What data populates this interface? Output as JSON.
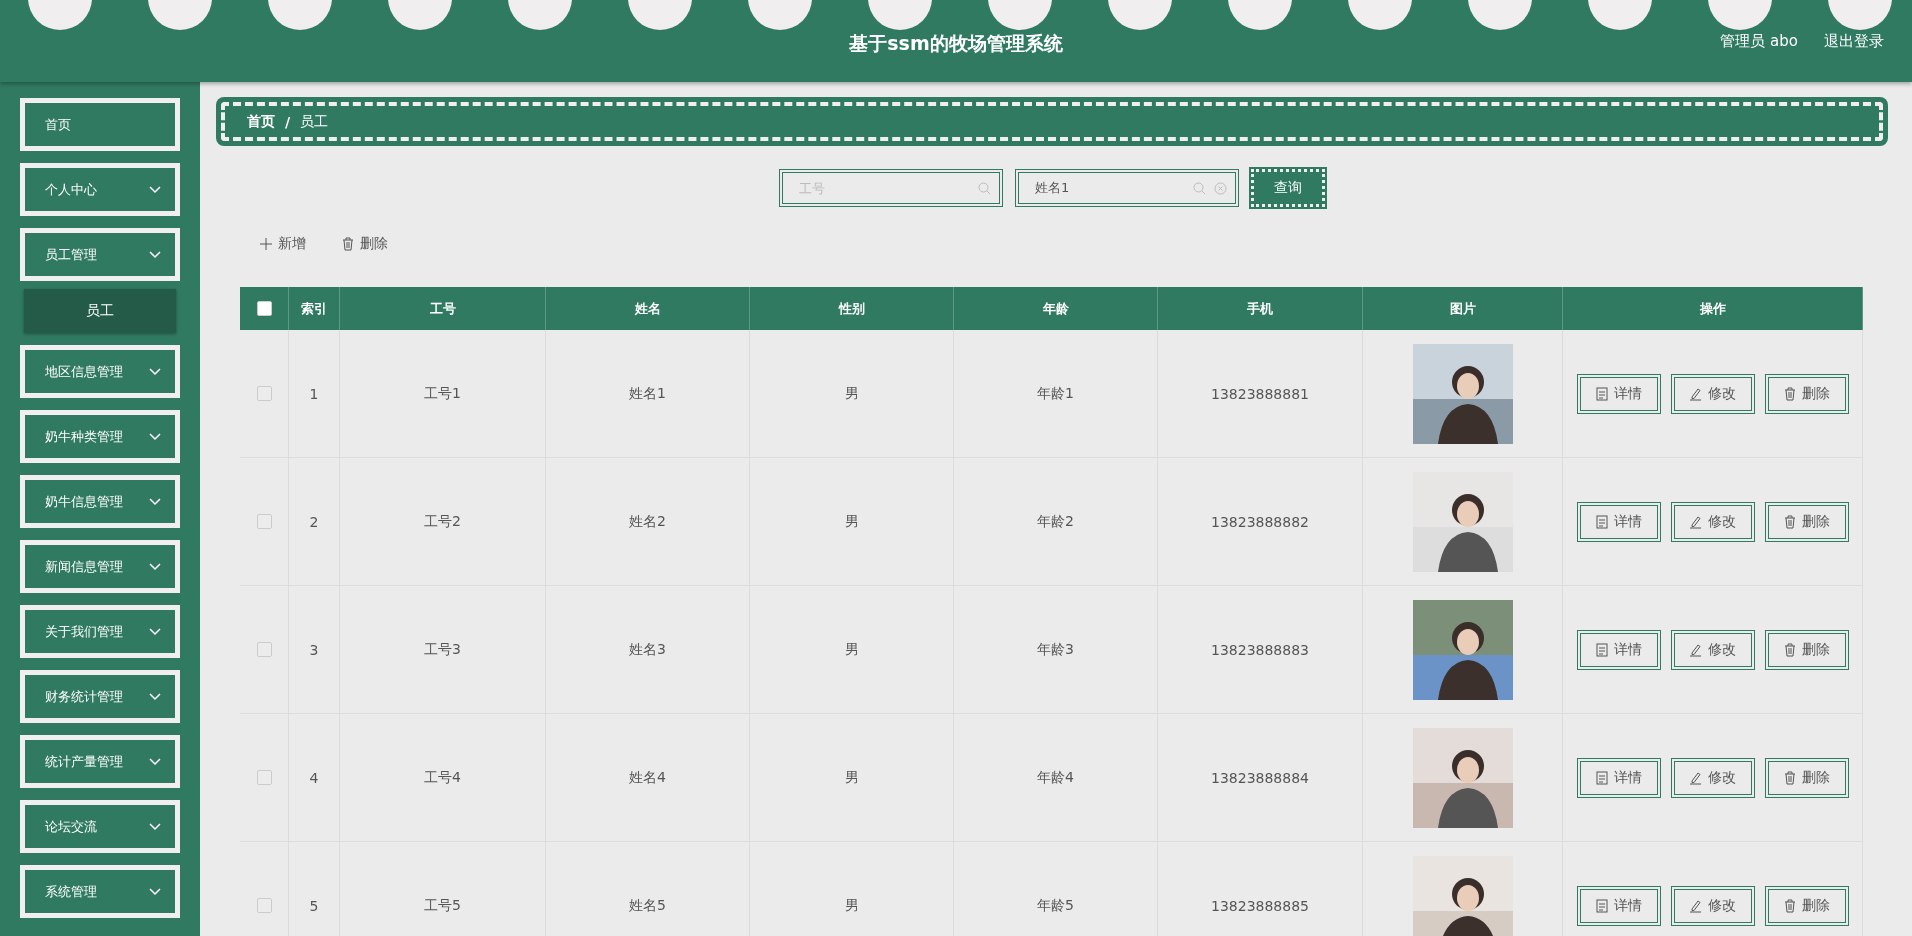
{
  "header": {
    "title": "基于ssm的牧场管理系统",
    "user": "管理员 abo",
    "logout": "退出登录"
  },
  "sidebar": {
    "items": [
      {
        "label": "首页",
        "kind": "link"
      },
      {
        "label": "个人中心",
        "kind": "submenu"
      },
      {
        "label": "员工管理",
        "kind": "submenu",
        "children": [
          {
            "label": "员工",
            "selected": true
          }
        ]
      },
      {
        "label": "地区信息管理",
        "kind": "submenu"
      },
      {
        "label": "奶牛种类管理",
        "kind": "submenu"
      },
      {
        "label": "奶牛信息管理",
        "kind": "submenu"
      },
      {
        "label": "新闻信息管理",
        "kind": "submenu"
      },
      {
        "label": "关于我们管理",
        "kind": "submenu"
      },
      {
        "label": "财务统计管理",
        "kind": "submenu"
      },
      {
        "label": "统计产量管理",
        "kind": "submenu"
      },
      {
        "label": "论坛交流",
        "kind": "submenu"
      },
      {
        "label": "系统管理",
        "kind": "submenu"
      }
    ]
  },
  "breadcrumb": {
    "items": [
      "首页",
      "员工"
    ],
    "separator": "/"
  },
  "search": {
    "fields": [
      {
        "placeholder": "工号"
      },
      {
        "value": "姓名1"
      }
    ],
    "button": "查询"
  },
  "actions": {
    "add": "新增",
    "delete": "删除"
  },
  "table": {
    "header_checked": false,
    "columns": [
      "索引",
      "工号",
      "姓名",
      "性别",
      "年龄",
      "手机",
      "图片",
      "操作"
    ],
    "rows": [
      {
        "checked": false,
        "cells": [
          "1",
          "工号1",
          "姓名1",
          "男",
          "年龄1",
          "13823888881"
        ],
        "buttons": [
          "详情",
          "修改",
          "删除"
        ]
      },
      {
        "checked": false,
        "cells": [
          "2",
          "工号2",
          "姓名2",
          "男",
          "年龄2",
          "13823888882"
        ],
        "buttons": [
          "详情",
          "修改",
          "删除"
        ]
      },
      {
        "checked": false,
        "cells": [
          "3",
          "工号3",
          "姓名3",
          "男",
          "年龄3",
          "13823888883"
        ],
        "buttons": [
          "详情",
          "修改",
          "删除"
        ]
      },
      {
        "checked": false,
        "cells": [
          "4",
          "工号4",
          "姓名4",
          "男",
          "年龄4",
          "13823888884"
        ],
        "buttons": [
          "详情",
          "修改",
          "删除"
        ]
      },
      {
        "checked": false,
        "cells": [
          "5",
          "工号5",
          "姓名5",
          "男",
          "年龄5",
          "13823888885"
        ],
        "buttons": [
          "详情",
          "修改",
          "删除"
        ]
      }
    ]
  }
}
